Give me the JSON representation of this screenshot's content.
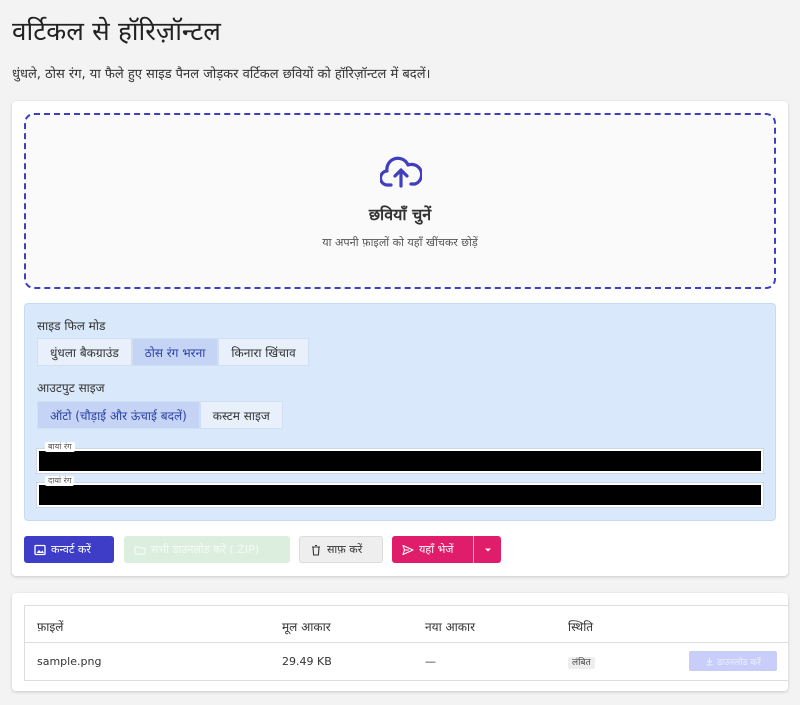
{
  "page": {
    "title": "वर्टिकल से हॉरिज़ॉन्टल",
    "subtitle": "धुंधले, ठोस रंग, या फैले हुए साइड पैनल जोड़कर वर्टिकल छवियों को हॉरिज़ॉन्टल में बदलें।"
  },
  "dropzone": {
    "icon": "cloud-upload-icon",
    "title": "छवियाँ चुनें",
    "subtitle": "या अपनी फ़ाइलों को यहाँ खींचकर छोड़ें"
  },
  "options": {
    "fill_mode_label": "साइड फिल मोड",
    "fill_modes": [
      {
        "label": "धुंधला बैकग्राउंड",
        "active": false
      },
      {
        "label": "ठोस रंग भरना",
        "active": true
      },
      {
        "label": "किनारा खिंचाव",
        "active": false
      }
    ],
    "output_size_label": "आउटपुट साइज",
    "output_sizes": [
      {
        "label": "ऑटो (चौड़ाई और ऊंचाई बदलें)",
        "active": true
      },
      {
        "label": "कस्टम साइज",
        "active": false
      }
    ],
    "left_color_label": "बायां रंग",
    "left_color": "#000000",
    "right_color_label": "दायां रंग",
    "right_color": "#000000"
  },
  "actions": {
    "convert": "कन्वर्ट करें",
    "download_all": "सभी डाउनलोड करें (.ZIP)",
    "clear": "साफ़ करें",
    "send_here": "यहाँ भेजें"
  },
  "table": {
    "headers": [
      "फ़ाइलें",
      "मूल आकार",
      "नया आकार",
      "स्थिति"
    ],
    "rows": [
      {
        "file": "sample.png",
        "original_size": "29.49 KB",
        "new_size": "—",
        "status": "लंबित",
        "download": "डाउनलोड करें"
      }
    ]
  },
  "colors": {
    "primary": "#3d3dc8",
    "accent": "#df1d6b",
    "options_bg": "#d9e9fb"
  }
}
